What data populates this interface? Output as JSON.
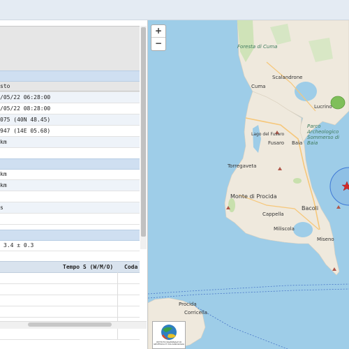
{
  "map": {
    "zoom_in": "+",
    "zoom_out": "−",
    "labels": {
      "scalandrone": "Scalandrone",
      "cuma": "Cuma",
      "lucrino": "Lucrino",
      "lago_fusaro": "Lago del Fusaro",
      "fusaro": "Fusaro",
      "baia": "Baia",
      "parco": "Parco Archeologico Sommerso di Baia",
      "torregaveta": "Torregaveta",
      "monte_di_procida": "Monte di Procida",
      "bacoli": "Bacoli",
      "cappella": "Cappella",
      "miliscola": "Miliscola",
      "miseno": "Miseno",
      "procida": "Procida",
      "corricella": "Corricella",
      "foresta": "Foresta di Cuma"
    },
    "colors": {
      "sea": "#9ecde8",
      "land": "#f1ede3",
      "circle": "#3f79d6",
      "star": "#d22b2b"
    }
  },
  "event": {
    "rows": [
      "sto",
      "/05/22 06:28:00",
      "/05/22 08:28:00",
      "075 (40N 48.45)",
      "947 (14E 05.68)",
      "km",
      "",
      "km",
      "km",
      "",
      "s",
      "",
      "3.4 ± 0.3"
    ],
    "magnitude": "3.4 ± 0.3"
  },
  "table": {
    "col_s": "Tempo S (W/M/O)",
    "col_coda": "Coda"
  },
  "logo_text": "ISTITUTO NAZIONALE DI GEOFISICA E VULCANOLOGIA"
}
